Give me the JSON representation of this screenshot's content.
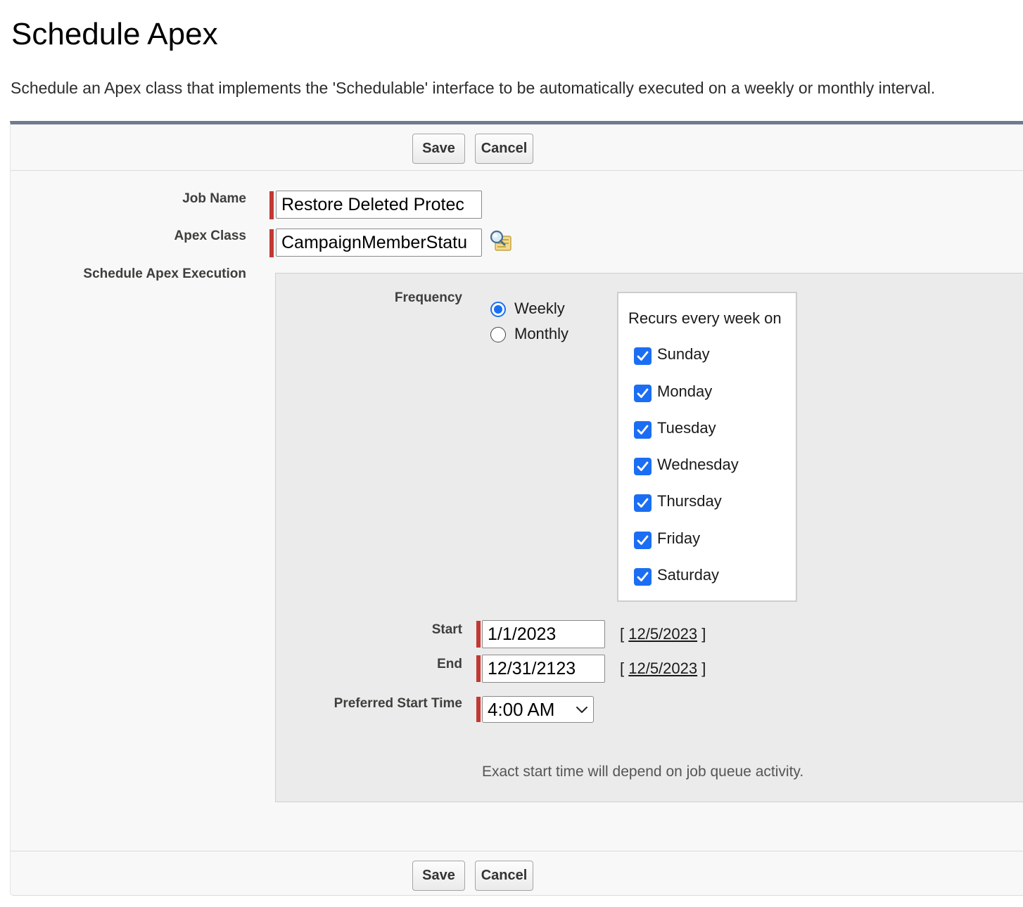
{
  "page": {
    "title": "Schedule Apex",
    "description": "Schedule an Apex class that implements the 'Schedulable' interface to be automatically executed on a weekly or monthly interval."
  },
  "buttons": {
    "save": "Save",
    "cancel": "Cancel"
  },
  "form": {
    "job_name": {
      "label": "Job Name",
      "value": "Restore Deleted Protec"
    },
    "apex_class": {
      "label": "Apex Class",
      "value": "CampaignMemberStatu"
    },
    "execution_label": "Schedule Apex Execution",
    "frequency": {
      "label": "Frequency",
      "options": [
        "Weekly",
        "Monthly"
      ],
      "selected": "Weekly"
    },
    "recurrence": {
      "title": "Recurs every week on",
      "days": [
        {
          "label": "Sunday",
          "checked": true
        },
        {
          "label": "Monday",
          "checked": true
        },
        {
          "label": "Tuesday",
          "checked": true
        },
        {
          "label": "Wednesday",
          "checked": true
        },
        {
          "label": "Thursday",
          "checked": true
        },
        {
          "label": "Friday",
          "checked": true
        },
        {
          "label": "Saturday",
          "checked": true
        }
      ]
    },
    "start": {
      "label": "Start",
      "value": "1/1/2023",
      "today_link": "12/5/2023"
    },
    "end": {
      "label": "End",
      "value": "12/31/2123",
      "today_link": "12/5/2023"
    },
    "preferred_time": {
      "label": "Preferred Start Time",
      "value": "4:00 AM"
    },
    "note": "Exact start time will depend on job queue activity."
  },
  "colors": {
    "required": "#c23934",
    "accent": "#1b6ef3",
    "panel_top": "#6f7b8c"
  },
  "icons": {
    "lookup": "lookup-magnifier-icon",
    "dropdown": "chevron-down-icon",
    "check": "checkmark-icon"
  }
}
